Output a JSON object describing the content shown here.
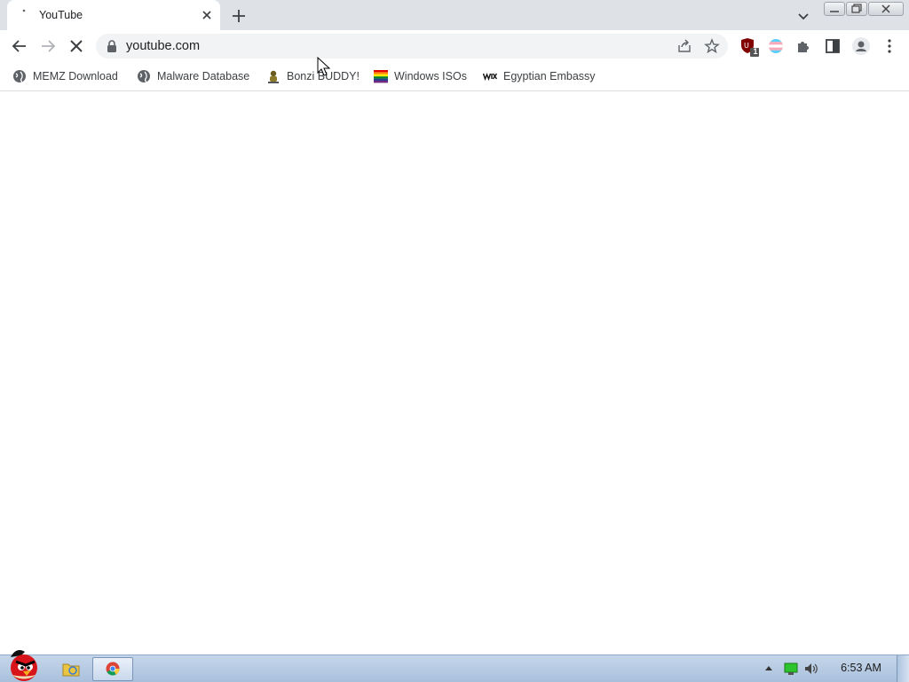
{
  "browser": {
    "tab": {
      "title": "YouTube",
      "favicon": "loading-dot-icon"
    },
    "omnibox": {
      "url": "youtube.com"
    },
    "extension_badge": "1",
    "bookmarks": [
      {
        "label": "MEMZ Download",
        "icon": "globe-icon"
      },
      {
        "label": "Malware Database",
        "icon": "globe-icon"
      },
      {
        "label": "Bonzi BUDDY!",
        "icon": "bonzi-icon"
      },
      {
        "label": "Windows ISOs",
        "icon": "rainbow-flag-icon"
      },
      {
        "label": "Egyptian Embassy",
        "icon": "wix-icon"
      }
    ]
  },
  "taskbar": {
    "clock": "6:53 AM"
  },
  "colors": {
    "tabstrip": "#dee1e6",
    "omnibox": "#f1f3f4",
    "taskbar": "#b6cbe3"
  }
}
